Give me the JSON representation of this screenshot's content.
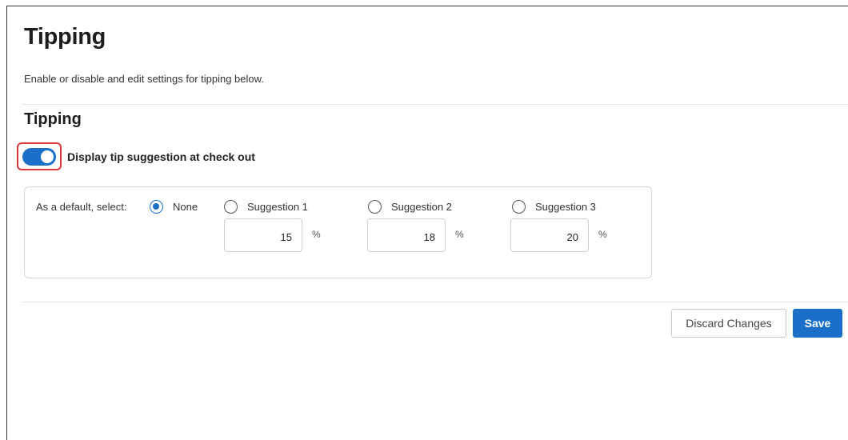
{
  "page": {
    "title": "Tipping",
    "description": "Enable or disable and edit settings for tipping below."
  },
  "section": {
    "title": "Tipping",
    "toggle": {
      "label": "Display tip suggestion at check out",
      "enabled": true
    }
  },
  "tip_options": {
    "default_label": "As a default, select:",
    "selected": "None",
    "options": [
      {
        "label": "None"
      },
      {
        "label": "Suggestion 1",
        "value": "15",
        "unit": "%"
      },
      {
        "label": "Suggestion 2",
        "value": "18",
        "unit": "%"
      },
      {
        "label": "Suggestion 3",
        "value": "20",
        "unit": "%"
      }
    ]
  },
  "actions": {
    "discard_label": "Discard Changes",
    "save_label": "Save"
  },
  "colors": {
    "accent": "#1b6fc8",
    "highlight": "#e0353a"
  }
}
